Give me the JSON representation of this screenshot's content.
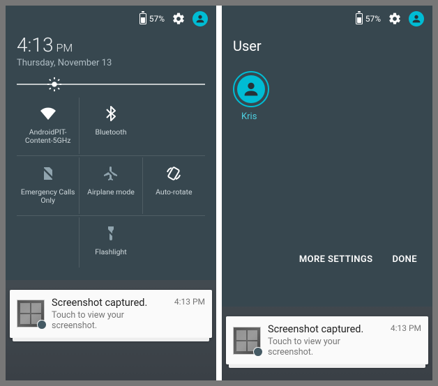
{
  "left": {
    "status": {
      "battery_pct": "57%"
    },
    "datetime": {
      "time": "4:13",
      "ampm": "PM",
      "date": "Thursday, November 13"
    },
    "tiles": {
      "wifi": "AndroidPIT-Content-5GHz",
      "bluetooth": "Bluetooth",
      "emergency": "Emergency Calls Only",
      "airplane": "Airplane mode",
      "autorotate": "Auto-rotate",
      "flashlight": "Flashlight"
    },
    "notification": {
      "title": "Screenshot captured.",
      "subtitle": "Touch to view your screenshot.",
      "time": "4:13 PM"
    }
  },
  "right": {
    "status": {
      "battery_pct": "57%"
    },
    "header": "User",
    "user": {
      "name": "Kris"
    },
    "actions": {
      "more": "MORE SETTINGS",
      "done": "DONE"
    },
    "notification": {
      "title": "Screenshot captured.",
      "subtitle": "Touch to view your screenshot.",
      "time": "4:13 PM"
    }
  }
}
